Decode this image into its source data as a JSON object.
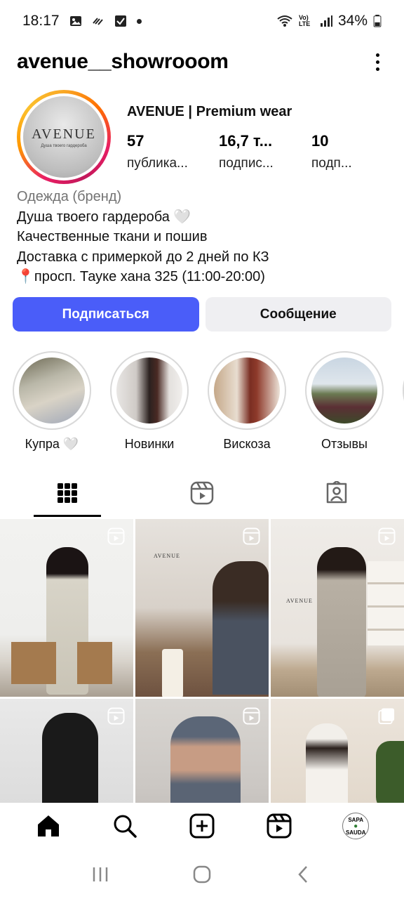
{
  "status_bar": {
    "time": "18:17",
    "network": "Vo) LTE",
    "battery": "34%"
  },
  "header": {
    "username": "avenue__showrooom"
  },
  "profile": {
    "avatar_logo": "AVENUE",
    "avatar_tagline": "Душа твоего гардероба",
    "display_name": "AVENUE | Premium wear",
    "stats": [
      {
        "number": "57",
        "label": "публика..."
      },
      {
        "number": "16,7 т...",
        "label": "подпис..."
      },
      {
        "number": "10",
        "label": "подп..."
      }
    ],
    "category": "Одежда (бренд)",
    "bio_lines": [
      "Душа твоего гардероба 🤍",
      "Качественные ткани и пошив",
      "Доставка с примеркой до 2 дней по КЗ",
      "📍просп. Тауке хана 325 (11:00-20:00)"
    ]
  },
  "actions": {
    "follow": "Подписаться",
    "message": "Сообщение"
  },
  "highlights": [
    {
      "label": "Купра 🤍"
    },
    {
      "label": "Новинки"
    },
    {
      "label": "Вискоза"
    },
    {
      "label": "Отзывы"
    }
  ],
  "tabs": {
    "grid": "grid-icon",
    "reels": "reels-icon",
    "tagged": "tagged-icon"
  },
  "posts": {
    "post2_brand": "AVENUE",
    "post3_brand": "AVENUE"
  },
  "bottom_nav": {
    "avatar_text_top": "SAPA",
    "avatar_text_bottom": "SAUDA"
  },
  "colors": {
    "accent": "#4a5df9",
    "secondary_button": "#efeff2",
    "muted_text": "#737373"
  }
}
